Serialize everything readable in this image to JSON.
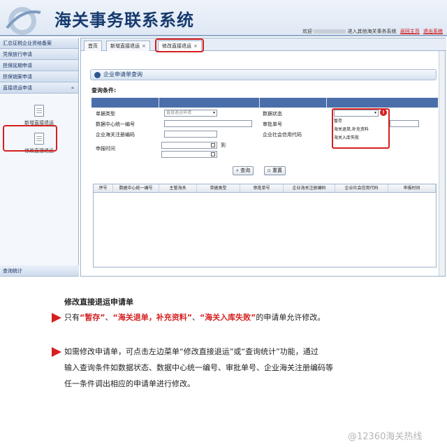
{
  "header": {
    "title": "海关事务联系系统",
    "welcome_prefix": "欢迎",
    "welcome_suffix": "进入其他海关事务系统",
    "links": [
      "返回主页",
      "退出系统"
    ]
  },
  "sidebar": {
    "menu": [
      {
        "label": "汇总征税企业资格备案"
      },
      {
        "label": "凭保放行申请"
      },
      {
        "label": "担保延期申请"
      },
      {
        "label": "担保销案申请"
      },
      {
        "label": "直接退运申请",
        "chevron": "«"
      }
    ],
    "sub_items": [
      {
        "label": "新增直接退运",
        "icon": "document-icon"
      },
      {
        "label": "修改直接退运",
        "icon": "document-icon"
      }
    ],
    "bottom": "查询统计"
  },
  "tabs": [
    {
      "label": "首页"
    },
    {
      "label": "新增直接退运",
      "close": "×"
    },
    {
      "label": "修改直接退运",
      "close": "×"
    }
  ],
  "query": {
    "section_title": "企业申请单查询",
    "conditions_label": "查询条件:",
    "fields": {
      "bill_type": "单据类型",
      "bill_type_value": "直接退运申请",
      "center_code": "数据中心统一编号",
      "customs_reg": "企业海关注册编码",
      "declare_time": "申报时间",
      "to": "到",
      "data_status": "数据状态",
      "approval_no": "审批单号",
      "credit_code": "企业社会信用代码"
    },
    "status_options": [
      "暂存",
      "海关退单,补充资料",
      "海关入库失败"
    ],
    "buttons": {
      "search": "查询",
      "reset": "重置"
    }
  },
  "grid": {
    "columns": [
      "序号",
      "数据中心统一编号",
      "主管海关",
      "单据类型",
      "审批单号",
      "企业海关注册编码",
      "企业社会信用代码",
      "申报时间"
    ]
  },
  "caption": {
    "title": "修改直接退运申请单",
    "p1_a": "只有",
    "p1_h1": "“暂存”",
    "p1_b": "、",
    "p1_h2": "“海关退单，补充资料”",
    "p1_c": "、",
    "p1_h3": "“海关入库失败”",
    "p1_d": "的申请单允许修改。",
    "p2_l1": "如需修改申请单，可点击左边菜单“修改直接退运”或“查询统计”功能，通过",
    "p2_l2": "输入查询条件如数据状态、数据中心统一编号、审批单号、企业海关注册编码等",
    "p2_l3": "任一条件调出相应的申请单进行修改。"
  },
  "watermark": "@12360海关热线",
  "colors": {
    "accent": "#d61f1f",
    "brand": "#163a6e",
    "header_bar": "#4a6ea9"
  }
}
